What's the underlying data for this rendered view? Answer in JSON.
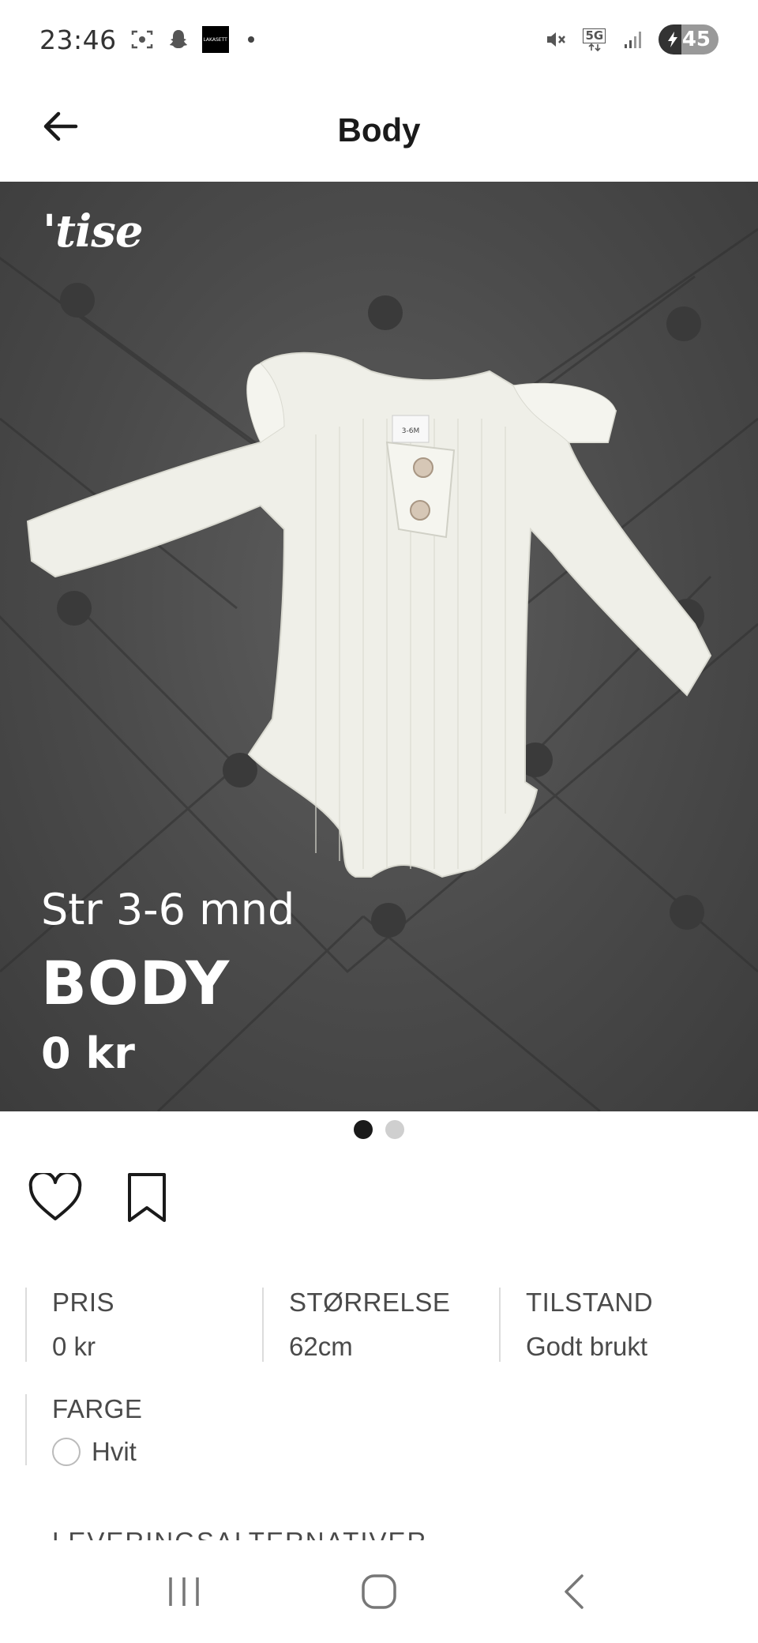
{
  "status_bar": {
    "time": "23:46",
    "app_icon_text": "LAKASETT",
    "network": "5G",
    "battery": "45"
  },
  "header": {
    "title": "Body"
  },
  "hero": {
    "brand": "'tise",
    "size_text": "Str 3-6 mnd",
    "name_text": "BODY",
    "price_text": "0 kr",
    "tag_text": "3-6M",
    "image_count": 2,
    "active_image": 1
  },
  "specs": [
    {
      "label": "PRIS",
      "value": "0 kr"
    },
    {
      "label": "STØRRELSE",
      "value": "62cm"
    },
    {
      "label": "TILSTAND",
      "value": "Godt brukt"
    }
  ],
  "color": {
    "label": "FARGE",
    "value": "Hvit",
    "swatch": "#ffffff"
  },
  "delivery_heading": "LEVERINGSALTERNATIVER"
}
